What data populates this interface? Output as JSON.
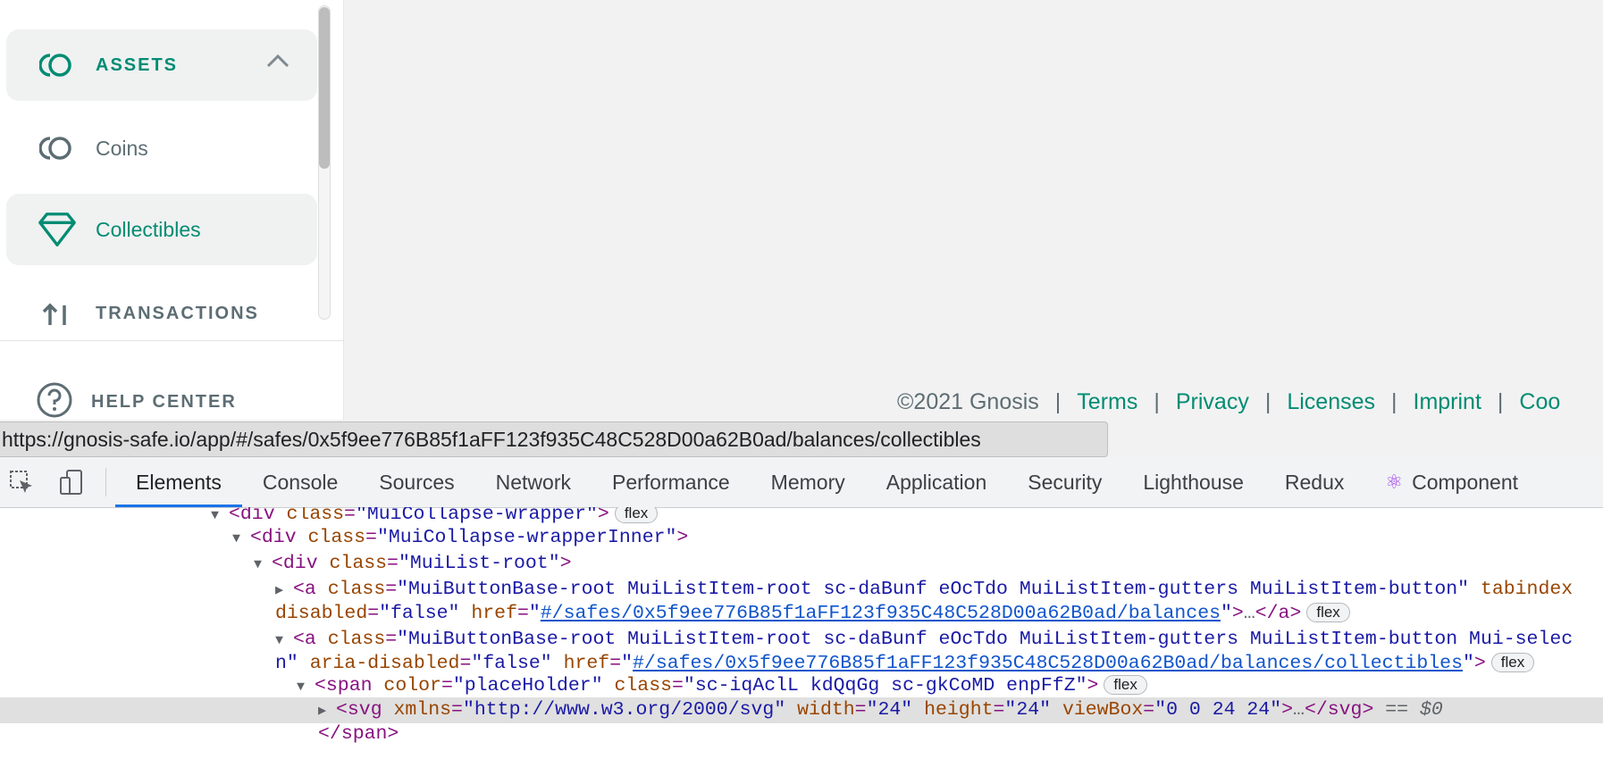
{
  "sidebar": {
    "assets_label": "ASSETS",
    "coins_label": "Coins",
    "collectibles_label": "Collectibles",
    "transactions_label": "TRANSACTIONS",
    "help_center_label": "HELP CENTER"
  },
  "footer": {
    "copyright": "©2021 Gnosis",
    "separator": "|",
    "links": [
      "Terms",
      "Privacy",
      "Licenses",
      "Imprint",
      "Coo"
    ]
  },
  "url_tooltip": "https://gnosis-safe.io/app/#/safes/0x5f9ee776B85f1aFF123f935C48C528D00a62B0ad/balances/collectibles",
  "devtools": {
    "tabs": [
      "Elements",
      "Console",
      "Sources",
      "Network",
      "Performance",
      "Memory",
      "Application",
      "Security",
      "Lighthouse",
      "Redux",
      "Component"
    ],
    "selected_tab": "Elements",
    "dom": {
      "l1_tag": "div",
      "l1_attr": "class",
      "l1_val": "MuiCollapse-wrapper",
      "l1_badge": "flex",
      "l2_tag": "div",
      "l2_attr": "class",
      "l2_val": "MuiCollapse-wrapperInner",
      "l3_tag": "div",
      "l3_attr": "class",
      "l3_val": "MuiList-root",
      "l4_tag": "a",
      "l4_attr": "class",
      "l4_val": "MuiButtonBase-root MuiListItem-root sc-daBunf eOcTdo MuiListItem-gutters MuiListItem-button",
      "l4_attr2": "tabindex",
      "l5_attr": "disabled",
      "l5_val": "false",
      "l5_attr2": "href",
      "l5_href": "#/safes/0x5f9ee776B85f1aFF123f935C48C528D00a62B0ad/balances",
      "l5_badge": "flex",
      "l6_tag": "a",
      "l6_attr": "class",
      "l6_val": "MuiButtonBase-root MuiListItem-root sc-daBunf eOcTdo MuiListItem-gutters MuiListItem-button Mui-selec",
      "l7_prefix": "n",
      "l7_attr": "aria-disabled",
      "l7_val": "false",
      "l7_attr2": "href",
      "l7_href": "#/safes/0x5f9ee776B85f1aFF123f935C48C528D00a62B0ad/balances/collectibles",
      "l7_badge": "flex",
      "l8_tag": "span",
      "l8_attr": "color",
      "l8_val": "placeHolder",
      "l8_attr2": "class",
      "l8_val2": "sc-iqAclL kdQqGg sc-gkCoMD enpFfZ",
      "l8_badge": "flex",
      "l9_tag": "svg",
      "l9_attr": "xmlns",
      "l9_val": "http://www.w3.org/2000/svg",
      "l9_attr2": "width",
      "l9_val2": "24",
      "l9_attr3": "height",
      "l9_val3": "24",
      "l9_attr4": "viewBox",
      "l9_val4": "0 0 24 24",
      "l9_eq": "== $0",
      "l10_tag": "span"
    }
  },
  "colors": {
    "accent": "#008c73",
    "muted": "#5d6d74",
    "devtools_blue": "#1a73e8"
  }
}
